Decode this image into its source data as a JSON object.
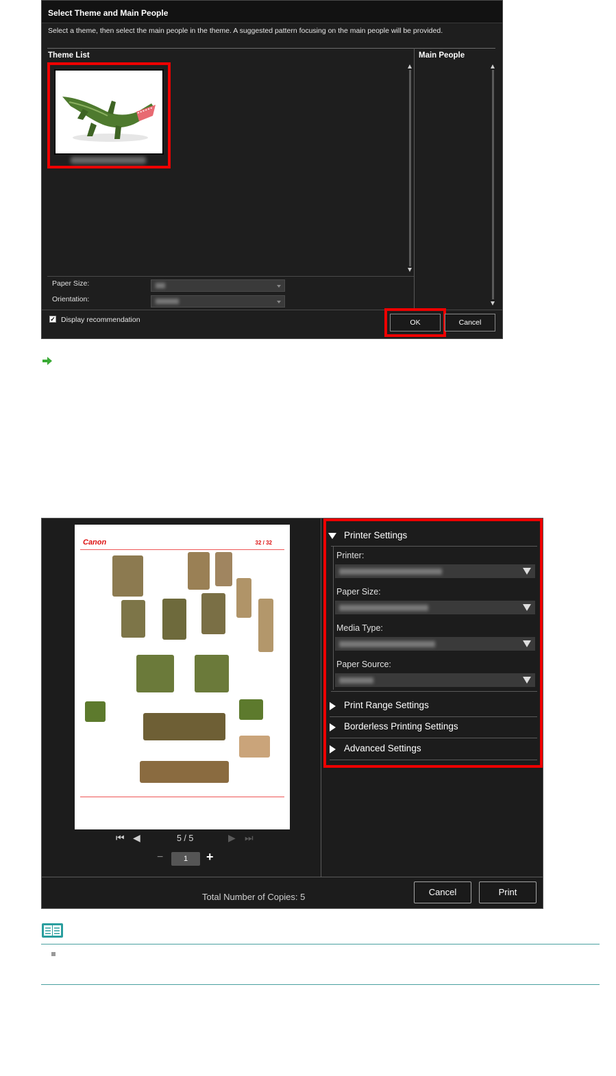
{
  "dialog1": {
    "title": "Select Theme and Main People",
    "subtitle": "Select a theme, then select the main people in the theme. A suggested pattern focusing on the main people will be provided.",
    "theme_list_label": "Theme List",
    "main_people_label": "Main People",
    "paper_size_label": "Paper Size:",
    "orientation_label": "Orientation:",
    "display_recommendation_label": "Display recommendation",
    "display_recommendation_checked": true,
    "ok_label": "OK",
    "cancel_label": "Cancel"
  },
  "dialog2": {
    "preview": {
      "logo": "Canon",
      "page_indicator": "32 / 32",
      "page_nav": "5 / 5",
      "copies": "1"
    },
    "printer_settings": {
      "title": "Printer Settings",
      "printer_label": "Printer:",
      "paper_size_label": "Paper Size:",
      "media_type_label": "Media Type:",
      "paper_source_label": "Paper Source:"
    },
    "collapsed_sections": [
      "Print Range Settings",
      "Borderless Printing Settings",
      "Advanced Settings"
    ],
    "total_copies_label": "Total Number of Copies:",
    "total_copies_value": "5",
    "cancel_label": "Cancel",
    "print_label": "Print"
  },
  "colors": {
    "highlight": "#e00000",
    "dialog_bg": "#1e1e1e",
    "note_rule": "#4aa0a0",
    "link_arrow": "#3aaa35"
  }
}
